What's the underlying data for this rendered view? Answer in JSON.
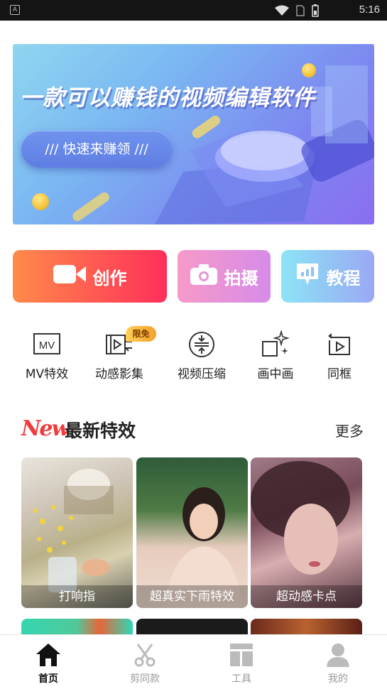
{
  "status_bar": {
    "time": "5:16",
    "icons": [
      "wifi-icon",
      "sim-icon",
      "battery-icon"
    ]
  },
  "banner": {
    "title": "一款可以赚钱的视频编辑软件",
    "pill": "/// 快速来赚领 ///"
  },
  "actions": [
    {
      "label": "创作",
      "icon": "video-camera-icon"
    },
    {
      "label": "拍摄",
      "icon": "camera-icon"
    },
    {
      "label": "教程",
      "icon": "tutorial-icon"
    }
  ],
  "tools": [
    {
      "label": "MV特效",
      "icon": "mv-icon"
    },
    {
      "label": "动感影集",
      "icon": "film-icon",
      "badge": "限免"
    },
    {
      "label": "视频压缩",
      "icon": "compress-icon"
    },
    {
      "label": "画中画",
      "icon": "picture-in-picture-icon"
    },
    {
      "label": "同框",
      "icon": "same-frame-icon"
    }
  ],
  "section": {
    "logo": "New",
    "title": "最新特效",
    "more": "更多"
  },
  "cards": [
    {
      "label": "打响指"
    },
    {
      "label": "超真实下雨特效"
    },
    {
      "label": "超动感卡点"
    }
  ],
  "bottom_nav": [
    {
      "label": "首页",
      "icon": "home-icon",
      "active": true
    },
    {
      "label": "剪同款",
      "icon": "scissors-icon",
      "active": false
    },
    {
      "label": "工具",
      "icon": "tools-icon",
      "active": false
    },
    {
      "label": "我的",
      "icon": "profile-icon",
      "active": false
    }
  ],
  "colors": {
    "create_gradient": [
      "#ff8a4a",
      "#ff2f5a"
    ],
    "shoot_gradient": [
      "#f79ac9",
      "#d68be8"
    ],
    "tutorial_gradient": [
      "#8ce4f6",
      "#9aa8f4"
    ],
    "new_logo": "#f23b3b"
  }
}
